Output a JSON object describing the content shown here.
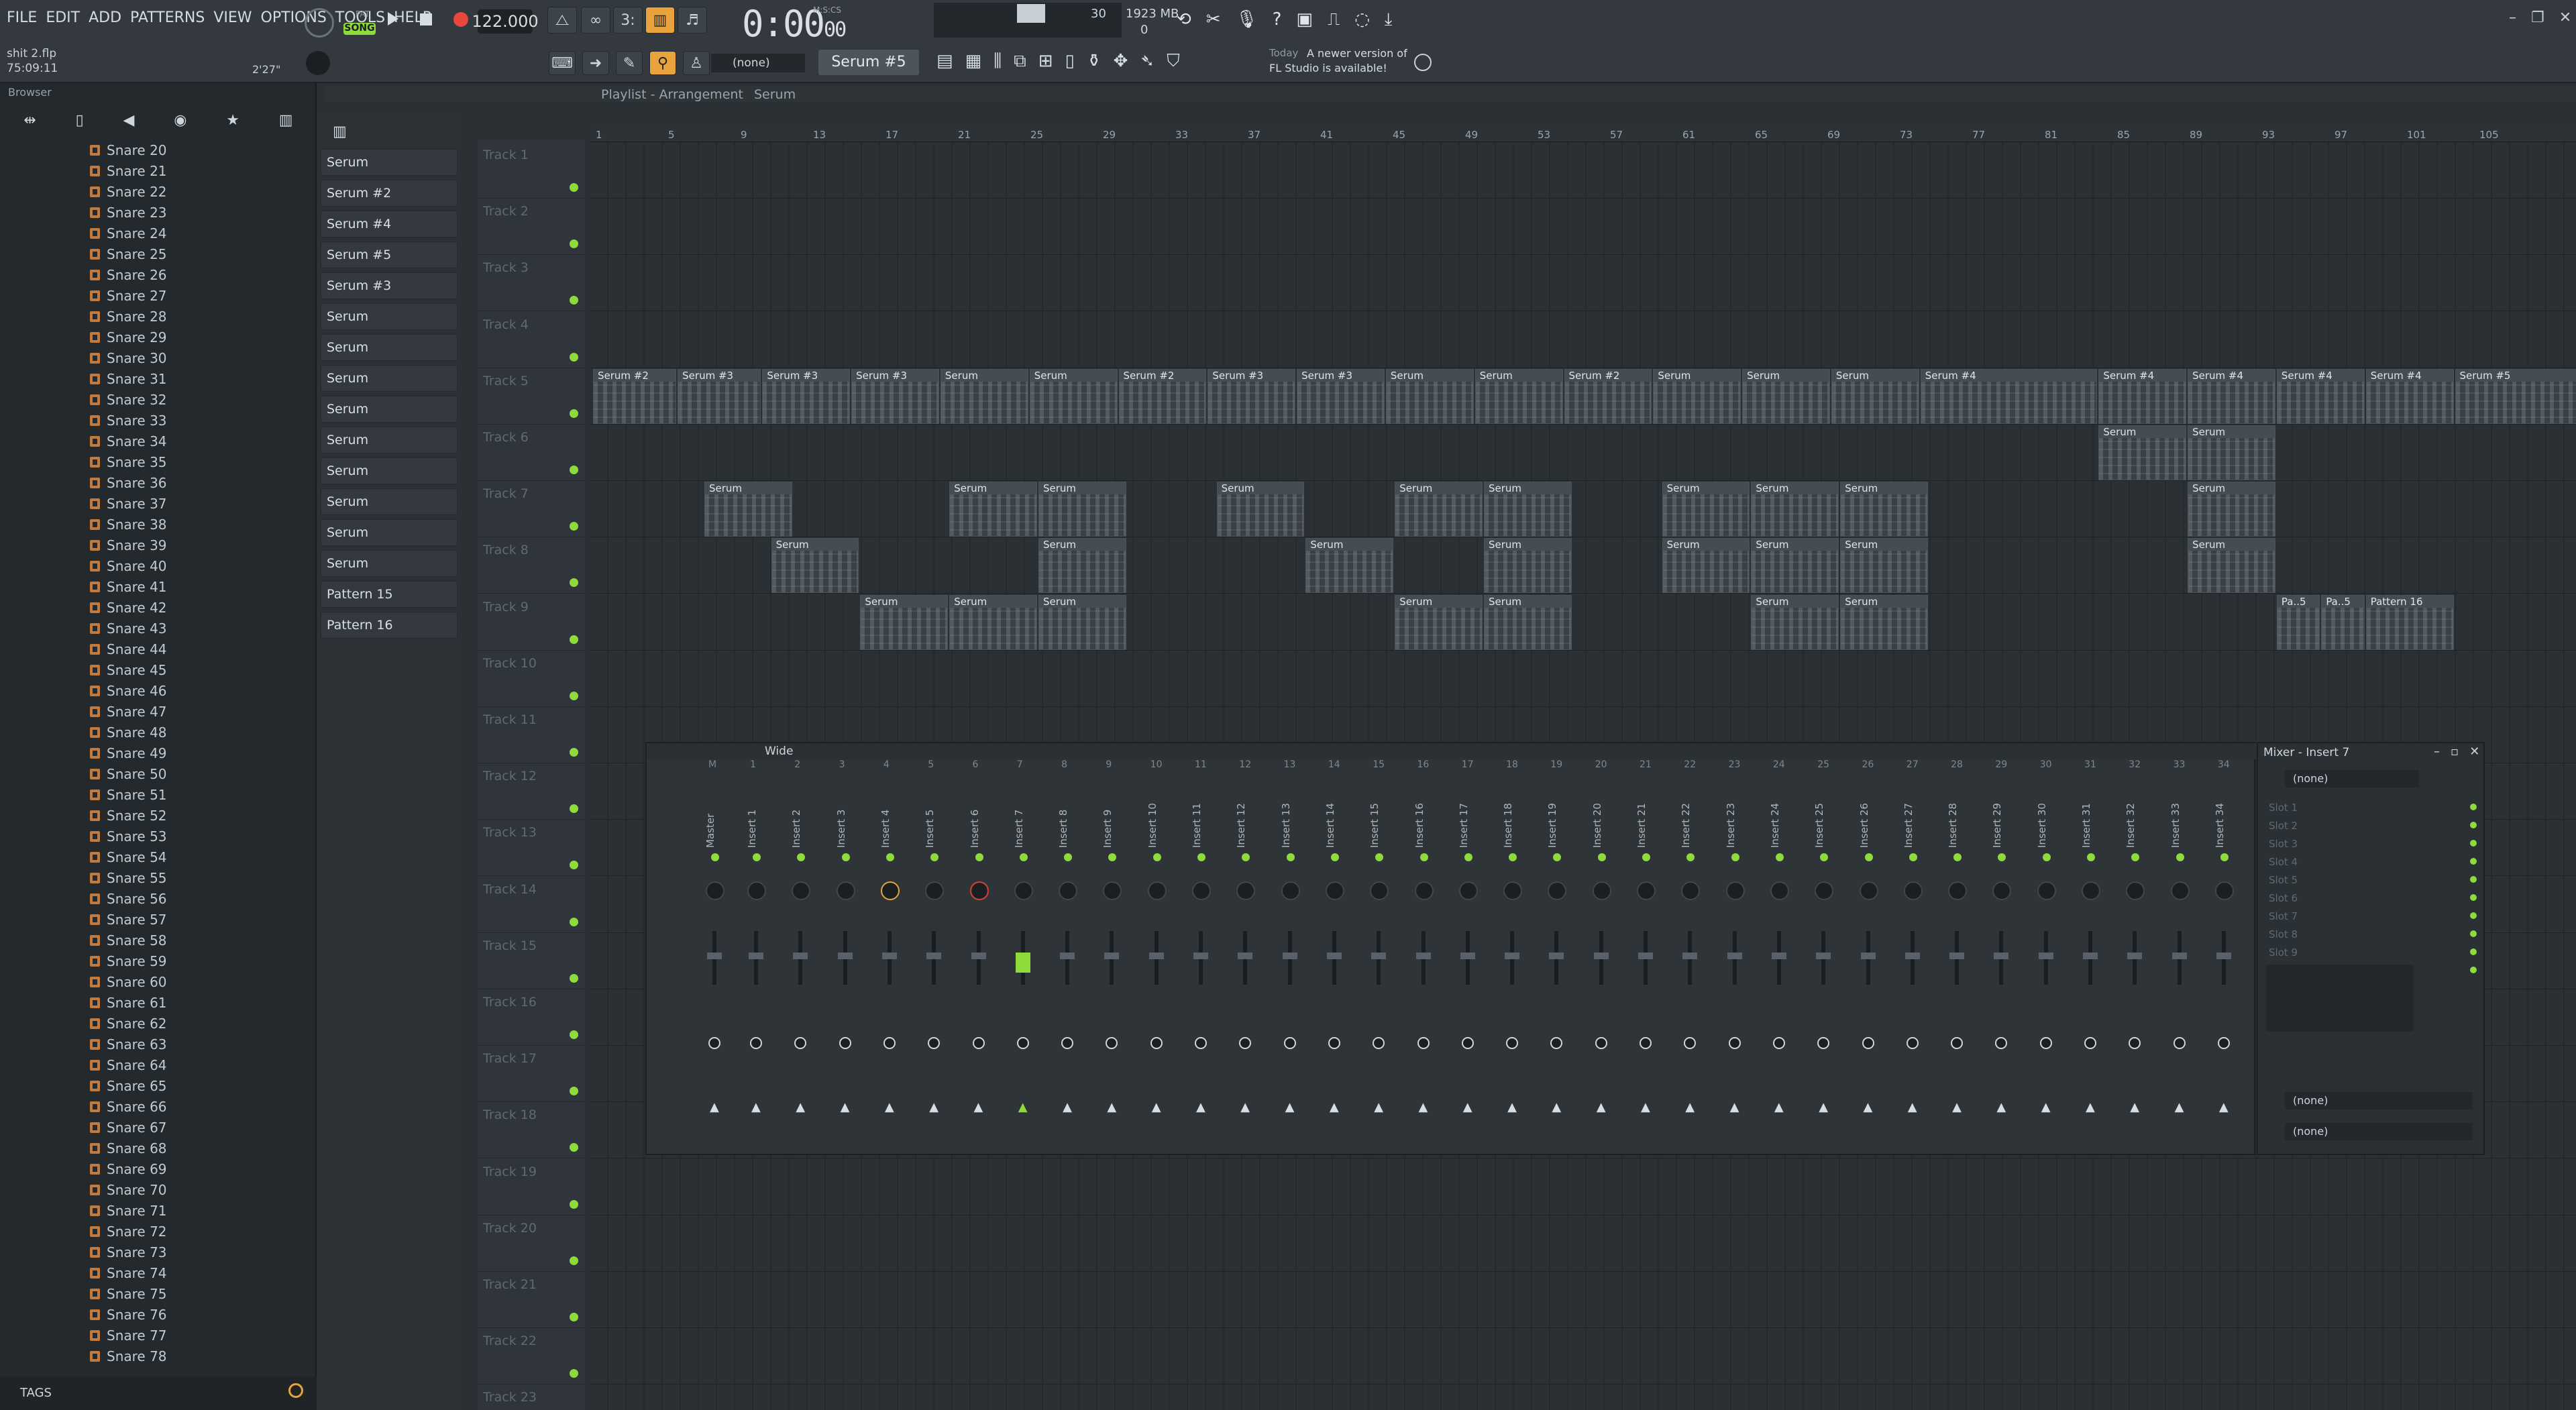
{
  "menu": [
    "FILE",
    "EDIT",
    "ADD",
    "PATTERNS",
    "VIEW",
    "OPTIONS",
    "TOOLS",
    "HELP"
  ],
  "transport": {
    "mode": "SONG",
    "pat": "PAT",
    "bpm": "122.000",
    "time": "0:00",
    "time_sub": "00",
    "msc": "M:S:CS",
    "cpu": "30",
    "mem": "1923 MB",
    "voices": "0"
  },
  "project": {
    "file": "shit 2.flp",
    "timestamp": "75:09:11",
    "length": "2'27\""
  },
  "toolbar2": {
    "snap": "(none)",
    "pattern": "Serum #5",
    "news_day": "Today",
    "news_text1": "A newer version of",
    "news_text2": "FL Studio is available!"
  },
  "browser": {
    "title": "Browser",
    "tags": "TAGS",
    "items": [
      "Snare 20",
      "Snare 21",
      "Snare 22",
      "Snare 23",
      "Snare 24",
      "Snare 25",
      "Snare 26",
      "Snare 27",
      "Snare 28",
      "Snare 29",
      "Snare 30",
      "Snare 31",
      "Snare 32",
      "Snare 33",
      "Snare 34",
      "Snare 35",
      "Snare 36",
      "Snare 37",
      "Snare 38",
      "Snare 39",
      "Snare 40",
      "Snare 41",
      "Snare 42",
      "Snare 43",
      "Snare 44",
      "Snare 45",
      "Snare 46",
      "Snare 47",
      "Snare 48",
      "Snare 49",
      "Snare 50",
      "Snare 51",
      "Snare 52",
      "Snare 53",
      "Snare 54",
      "Snare 55",
      "Snare 56",
      "Snare 57",
      "Snare 58",
      "Snare 59",
      "Snare 60",
      "Snare 61",
      "Snare 62",
      "Snare 63",
      "Snare 64",
      "Snare 65",
      "Snare 66",
      "Snare 67",
      "Snare 68",
      "Snare 69",
      "Snare 70",
      "Snare 71",
      "Snare 72",
      "Snare 73",
      "Snare 74",
      "Snare 75",
      "Snare 76",
      "Snare 77",
      "Snare 78"
    ]
  },
  "channels": [
    "Serum",
    "Serum #2",
    "Serum #4",
    "Serum #5",
    "Serum #3",
    "Serum",
    "Serum",
    "Serum",
    "Serum",
    "Serum",
    "Serum",
    "Serum",
    "Serum",
    "Serum",
    "Pattern 15",
    "Pattern 16"
  ],
  "playlist": {
    "title": "Playlist - Arrangement",
    "sub": "Serum",
    "tracks": [
      "Track 1",
      "Track 2",
      "Track 3",
      "Track 4",
      "Track 5",
      "Track 6",
      "Track 7",
      "Track 8",
      "Track 9",
      "Track 10",
      "Track 11",
      "Track 12",
      "Track 13",
      "Track 14",
      "Track 15",
      "Track 16",
      "Track 17",
      "Track 18",
      "Track 19",
      "Track 20",
      "Track 21",
      "Track 22",
      "Track 23"
    ],
    "ruler": [
      "1",
      "5",
      "9",
      "13",
      "17",
      "21",
      "25",
      "29",
      "33",
      "37",
      "41",
      "45",
      "49",
      "53",
      "57",
      "61",
      "65",
      "69",
      "73",
      "77",
      "81",
      "85",
      "89",
      "93",
      "97",
      "101",
      "105"
    ],
    "clips": [
      {
        "t": 4,
        "s": 0,
        "e": 38,
        "n": "Serum #2"
      },
      {
        "t": 4,
        "s": 38,
        "e": 76,
        "n": "Serum #3"
      },
      {
        "t": 4,
        "s": 76,
        "e": 116,
        "n": "Serum #3"
      },
      {
        "t": 4,
        "s": 116,
        "e": 156,
        "n": "Serum #3"
      },
      {
        "t": 4,
        "s": 156,
        "e": 196,
        "n": "Serum"
      },
      {
        "t": 4,
        "s": 196,
        "e": 236,
        "n": "Serum"
      },
      {
        "t": 4,
        "s": 236,
        "e": 276,
        "n": "Serum #2"
      },
      {
        "t": 4,
        "s": 276,
        "e": 316,
        "n": "Serum #3"
      },
      {
        "t": 4,
        "s": 316,
        "e": 356,
        "n": "Serum #3"
      },
      {
        "t": 4,
        "s": 356,
        "e": 396,
        "n": "Serum"
      },
      {
        "t": 4,
        "s": 396,
        "e": 436,
        "n": "Serum"
      },
      {
        "t": 4,
        "s": 436,
        "e": 476,
        "n": "Serum #2"
      },
      {
        "t": 4,
        "s": 476,
        "e": 516,
        "n": "Serum"
      },
      {
        "t": 4,
        "s": 516,
        "e": 556,
        "n": "Serum"
      },
      {
        "t": 4,
        "s": 556,
        "e": 596,
        "n": "Serum"
      },
      {
        "t": 4,
        "s": 596,
        "e": 676,
        "n": "Serum #4"
      },
      {
        "t": 4,
        "s": 676,
        "e": 716,
        "n": "Serum #4"
      },
      {
        "t": 4,
        "s": 716,
        "e": 756,
        "n": "Serum #4"
      },
      {
        "t": 4,
        "s": 756,
        "e": 796,
        "n": "Serum #4"
      },
      {
        "t": 4,
        "s": 796,
        "e": 836,
        "n": "Serum #4"
      },
      {
        "t": 4,
        "s": 836,
        "e": 900,
        "n": "Serum #5"
      },
      {
        "t": 5,
        "s": 676,
        "e": 716,
        "n": "Serum"
      },
      {
        "t": 5,
        "s": 716,
        "e": 756,
        "n": "Serum"
      },
      {
        "t": 6,
        "s": 50,
        "e": 90,
        "n": "Serum"
      },
      {
        "t": 6,
        "s": 160,
        "e": 200,
        "n": "Serum"
      },
      {
        "t": 6,
        "s": 200,
        "e": 240,
        "n": "Serum"
      },
      {
        "t": 6,
        "s": 280,
        "e": 320,
        "n": "Serum"
      },
      {
        "t": 6,
        "s": 360,
        "e": 400,
        "n": "Serum"
      },
      {
        "t": 6,
        "s": 400,
        "e": 440,
        "n": "Serum"
      },
      {
        "t": 6,
        "s": 480,
        "e": 520,
        "n": "Serum"
      },
      {
        "t": 6,
        "s": 520,
        "e": 560,
        "n": "Serum"
      },
      {
        "t": 6,
        "s": 560,
        "e": 600,
        "n": "Serum"
      },
      {
        "t": 6,
        "s": 716,
        "e": 756,
        "n": "Serum"
      },
      {
        "t": 7,
        "s": 80,
        "e": 120,
        "n": "Serum"
      },
      {
        "t": 7,
        "s": 200,
        "e": 240,
        "n": "Serum"
      },
      {
        "t": 7,
        "s": 320,
        "e": 360,
        "n": "Serum"
      },
      {
        "t": 7,
        "s": 400,
        "e": 440,
        "n": "Serum"
      },
      {
        "t": 7,
        "s": 480,
        "e": 520,
        "n": "Serum"
      },
      {
        "t": 7,
        "s": 520,
        "e": 560,
        "n": "Serum"
      },
      {
        "t": 7,
        "s": 560,
        "e": 600,
        "n": "Serum"
      },
      {
        "t": 7,
        "s": 716,
        "e": 756,
        "n": "Serum"
      },
      {
        "t": 8,
        "s": 120,
        "e": 160,
        "n": "Serum"
      },
      {
        "t": 8,
        "s": 160,
        "e": 200,
        "n": "Serum"
      },
      {
        "t": 8,
        "s": 200,
        "e": 240,
        "n": "Serum"
      },
      {
        "t": 8,
        "s": 360,
        "e": 400,
        "n": "Serum"
      },
      {
        "t": 8,
        "s": 400,
        "e": 440,
        "n": "Serum"
      },
      {
        "t": 8,
        "s": 520,
        "e": 560,
        "n": "Serum"
      },
      {
        "t": 8,
        "s": 560,
        "e": 600,
        "n": "Serum"
      },
      {
        "t": 8,
        "s": 756,
        "e": 776,
        "n": "Pa..5"
      },
      {
        "t": 8,
        "s": 776,
        "e": 796,
        "n": "Pa..5"
      },
      {
        "t": 8,
        "s": 796,
        "e": 836,
        "n": "Pattern 16"
      }
    ]
  },
  "mixer": {
    "preset": "Wide",
    "title": "Mixer - Insert 7",
    "strips": [
      "Master",
      "Insert 1",
      "Insert 2",
      "Insert 3",
      "Insert 4",
      "Insert 5",
      "Insert 6",
      "Insert 7",
      "Insert 8",
      "Insert 9",
      "Insert 10",
      "Insert 11",
      "Insert 12",
      "Insert 13",
      "Insert 14",
      "Insert 15",
      "Insert 16",
      "Insert 17",
      "Insert 18",
      "Insert 19",
      "Insert 20",
      "Insert 21",
      "Insert 22",
      "Insert 23",
      "Insert 24",
      "Insert 25",
      "Insert 26",
      "Insert 27",
      "Insert 28",
      "Insert 29",
      "Insert 30",
      "Insert 31",
      "Insert 32",
      "Insert 33",
      "Insert 34"
    ],
    "numbers": [
      "M",
      "1",
      "2",
      "3",
      "4",
      "5",
      "6",
      "7",
      "8",
      "9",
      "10",
      "11",
      "12",
      "13",
      "14",
      "15",
      "16",
      "17",
      "18",
      "19",
      "20",
      "21",
      "22",
      "23",
      "24",
      "25",
      "26",
      "27",
      "28",
      "29",
      "30",
      "31",
      "32",
      "33",
      "34"
    ],
    "slots": [
      "Slot 1",
      "Slot 2",
      "Slot 3",
      "Slot 4",
      "Slot 5",
      "Slot 6",
      "Slot 7",
      "Slot 8",
      "Slot 9",
      "Slot 10"
    ],
    "input": "(none)",
    "eq": "(none)",
    "output": "(none)",
    "accent": "#8edb3b"
  }
}
